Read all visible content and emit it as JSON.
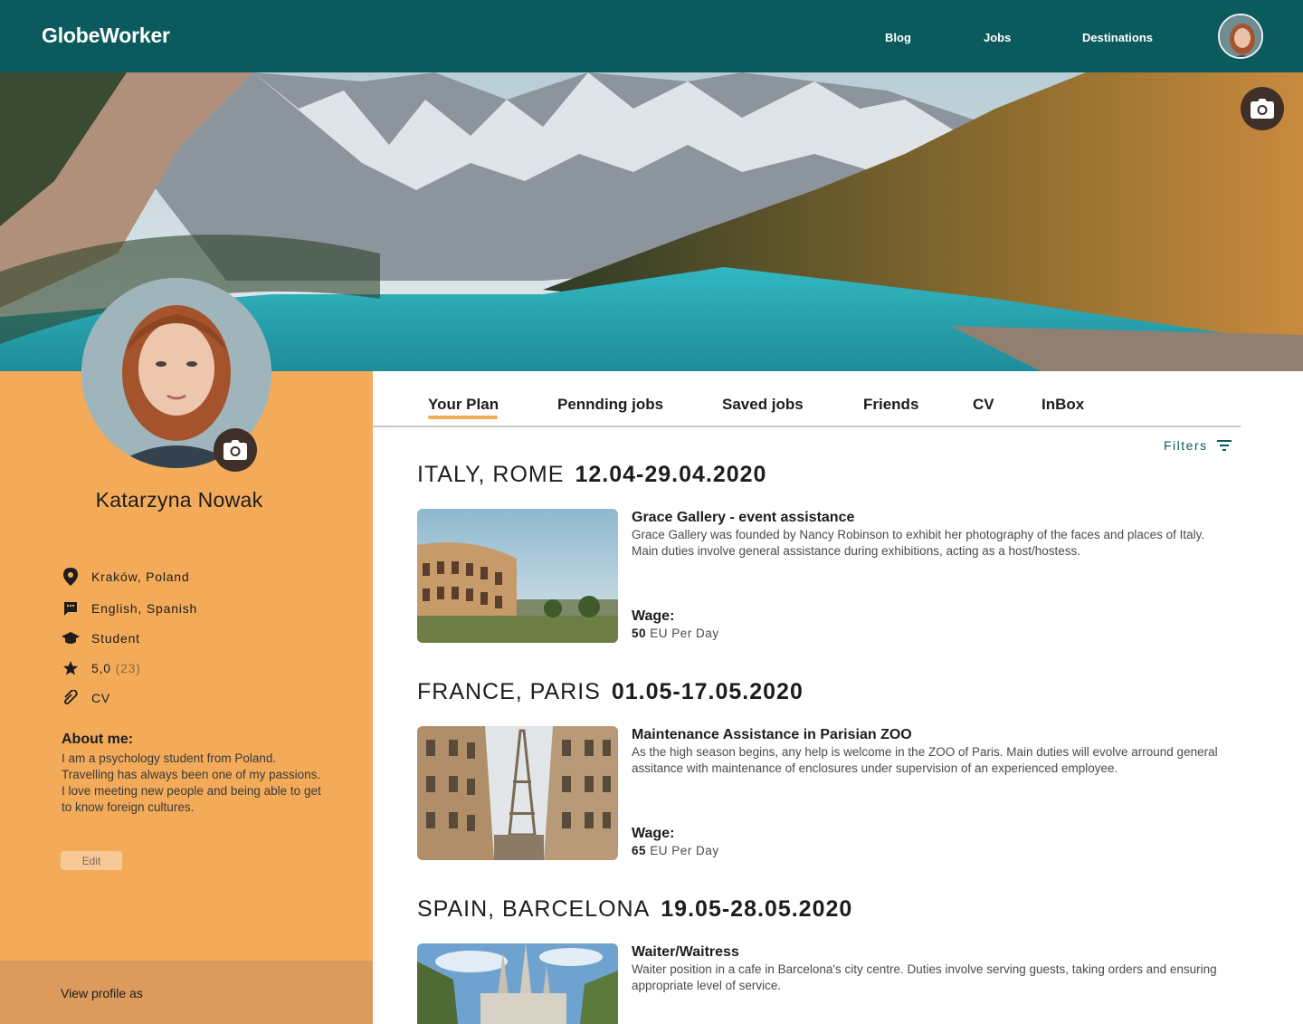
{
  "header": {
    "logo": "GlobeWorker",
    "nav": [
      {
        "label": "Blog"
      },
      {
        "label": "Jobs"
      },
      {
        "label": "Destinations"
      }
    ]
  },
  "profile": {
    "name": "Katarzyna Nowak",
    "location": "Kraków, Poland",
    "languages": "English, Spanish",
    "occupation": "Student",
    "rating": "5,0",
    "rating_count": "(23)",
    "cv": "CV",
    "about_title": "About me:",
    "about_text": "I am a psychology student from Poland. Travelling has always been one of my passions. I love meeting new people and being able to get to know foreign cultures.",
    "edit_label": "Edit",
    "view_as_label": "View profile as"
  },
  "tabs": [
    {
      "label": "Your Plan",
      "active": true
    },
    {
      "label": "Pennding jobs"
    },
    {
      "label": "Saved jobs"
    },
    {
      "label": "Friends"
    },
    {
      "label": "CV"
    },
    {
      "label": "InBox"
    }
  ],
  "filters_label": "Filters",
  "plans": [
    {
      "place": "ITALY, ROME",
      "dates": "12.04-29.04.2020",
      "job_title": "Grace Gallery - event assistance",
      "description": "Grace Gallery was founded by Nancy Robinson to exhibit her photography of the faces and places of Italy. Main duties involve general assistance during exhibitions, acting as a host/hostess.",
      "wage_label": "Wage:",
      "wage_amount": "50",
      "wage_unit": "EU Per Day"
    },
    {
      "place": "FRANCE, PARIS",
      "dates": "01.05-17.05.2020",
      "job_title": "Maintenance Assistance in Parisian ZOO",
      "description": "As the high season begins, any help is welcome in the ZOO of Paris. Main duties will evolve arround general assitance with maintenance of enclosures under supervision of an experienced employee.",
      "wage_label": "Wage:",
      "wage_amount": "65",
      "wage_unit": "EU Per Day"
    },
    {
      "place": "SPAIN, BARCELONA",
      "dates": "19.05-28.05.2020",
      "job_title": "Waiter/Waitress",
      "description": "Waiter position in a cafe in Barcelona's city centre. Duties involve serving guests, taking orders and ensuring appropriate level of service."
    }
  ],
  "colors": {
    "header": "#0b5a5d",
    "sidebar": "#f3ab59",
    "sidebar_footer": "#dc9a5d",
    "accent": "#f3ab59"
  },
  "icons": [
    "camera-icon",
    "location-pin-icon",
    "chat-icon",
    "graduation-cap-icon",
    "star-icon",
    "paperclip-icon",
    "filter-icon"
  ]
}
